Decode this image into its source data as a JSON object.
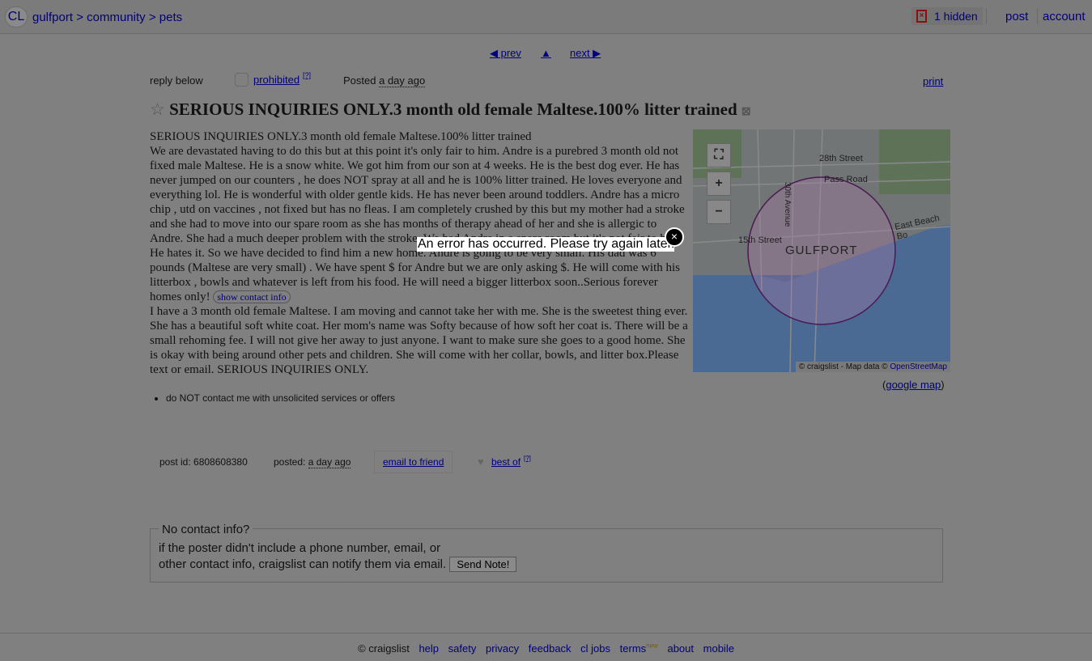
{
  "header": {
    "logo": "CL",
    "breadcrumb": [
      "gulfport",
      "community",
      "pets"
    ],
    "hidden_count": "1 hidden",
    "post": "post",
    "account": "account"
  },
  "nav": {
    "prev": "◀ prev",
    "up": "▲",
    "next": "next ▶"
  },
  "meta": {
    "reply": "reply below",
    "prohibited": "prohibited",
    "help_mark": "[?]",
    "posted_label": "Posted",
    "posted_value": "a day ago",
    "print": "print"
  },
  "title": "SERIOUS INQUIRIES ONLY.3 month old female Maltese.100% litter trained",
  "body": {
    "first_line": "SERIOUS INQUIRIES ONLY.3 month old female Maltese.100% litter trained",
    "p1": "We are devastated having to do this but at this point it's only fair to him. Andre is a purebred 3 month old not fixed male Maltese. He is a snow white. We got him from our son at 4 weeks. He is the best dog ever. He has never jumped on our counters , he does NOT spray at all and he is 100% litter trained. He loves everyone and everything lol. He is wonderful with older gentle kids. He has never been around toddlers. Andre has a micro chip , utd on vaccines , not fixed but has no fleas. I am completely crushed by this but my mother had a stroke and she had to move into our spare room as she has months of therapy ahead of her and she is allergic to Andre. She had a much deeper problem with the stroke. We had Andre in a spare room but it's not fair to him. He hates it. So we have decided to find him a new home. Andre is going to be very small. His dad was 6 pounds (Maltese are very small) . We have spent $ for Andre but we are only asking $. He will come with his litterbox , bowls and whatever is left from his food. He will need a bigger litterbox soon..Serious forever homes only! ",
    "show_contact": "show contact info",
    "p2": "I have a 3 month old female Maltese. I am moving and cannot take her with me. She is the sweetest thing ever. She has a beautiful soft white coat. Her mom's name was Softy because of how soft her coat is. There will be a small rehoming fee. I will not give her away to just anyone. I want to make sure she goes to a good home. She is okay with being around other pets and children. She will come with her collar, bowls, and litter box.Please text or email. SERIOUS INQUIRIES ONLY."
  },
  "map": {
    "labels": [
      "28th Street",
      "Pass Road",
      "30th Avenue",
      "East Beach Bo",
      "15th Street",
      "GULFPORT"
    ],
    "attribution": "© craigslist - Map data ©",
    "osm": "OpenStreetMap",
    "google_map": "google map"
  },
  "notices": [
    "do NOT contact me with unsolicited services or offers"
  ],
  "postinfo": {
    "post_id": "post id: 6808608380",
    "posted_label": "posted:",
    "posted_value": "a day ago",
    "email_friend": "email to friend",
    "best_of": "best of",
    "help_mark": "[?]"
  },
  "nocontact": {
    "legend": "No contact info?",
    "line1": "if the poster didn't include a phone number, email, or",
    "line2": "other contact info, craigslist can notify them via email.",
    "button": "Send Note!"
  },
  "popup": {
    "message": "An error has occurred. Please try again later.",
    "close": "×"
  },
  "footer": {
    "copyright": "© craigslist",
    "links": [
      "help",
      "safety",
      "privacy",
      "feedback",
      "cl jobs",
      "terms",
      "about",
      "mobile"
    ],
    "new_badge": "new"
  }
}
